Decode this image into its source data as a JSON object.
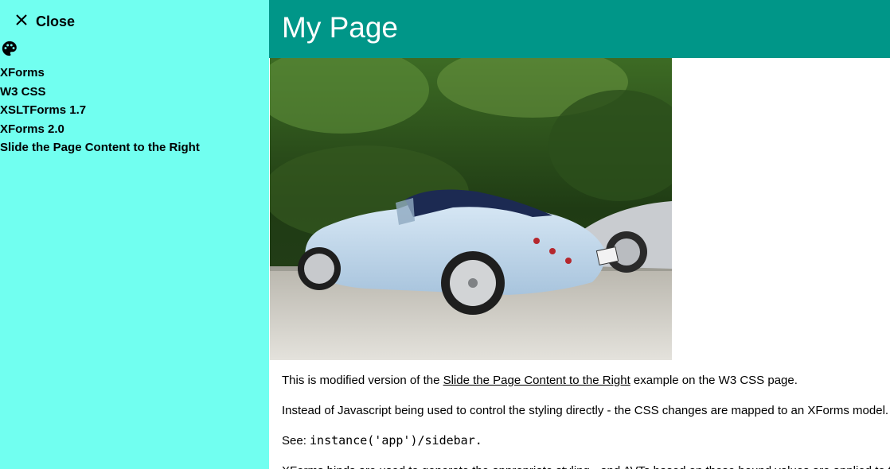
{
  "sidebar": {
    "close_label": "Close",
    "items": [
      {
        "label": "XForms"
      },
      {
        "label": "W3 CSS"
      },
      {
        "label": "XSLTForms 1.7"
      },
      {
        "label": "XForms 2.0"
      },
      {
        "label": "Slide the Page Content to the Right"
      }
    ]
  },
  "header": {
    "title": "My Page"
  },
  "content": {
    "p1_before": "This is modified version of the ",
    "p1_link": "Slide the Page Content to the Right",
    "p1_after": " example on the W3 CSS page.",
    "p2": "Instead of Javascript being used to control the styling directly - the CSS changes are mapped to an XForms model.",
    "p3_prefix": "See: ",
    "p3_code": "instance('app')/sidebar.",
    "p4": "XForms binds are used to generate the appropriate styling - and AVTs based on those bound values are applied to the"
  },
  "colors": {
    "sidebar_bg": "#71fff0",
    "header_bg": "#009688"
  }
}
